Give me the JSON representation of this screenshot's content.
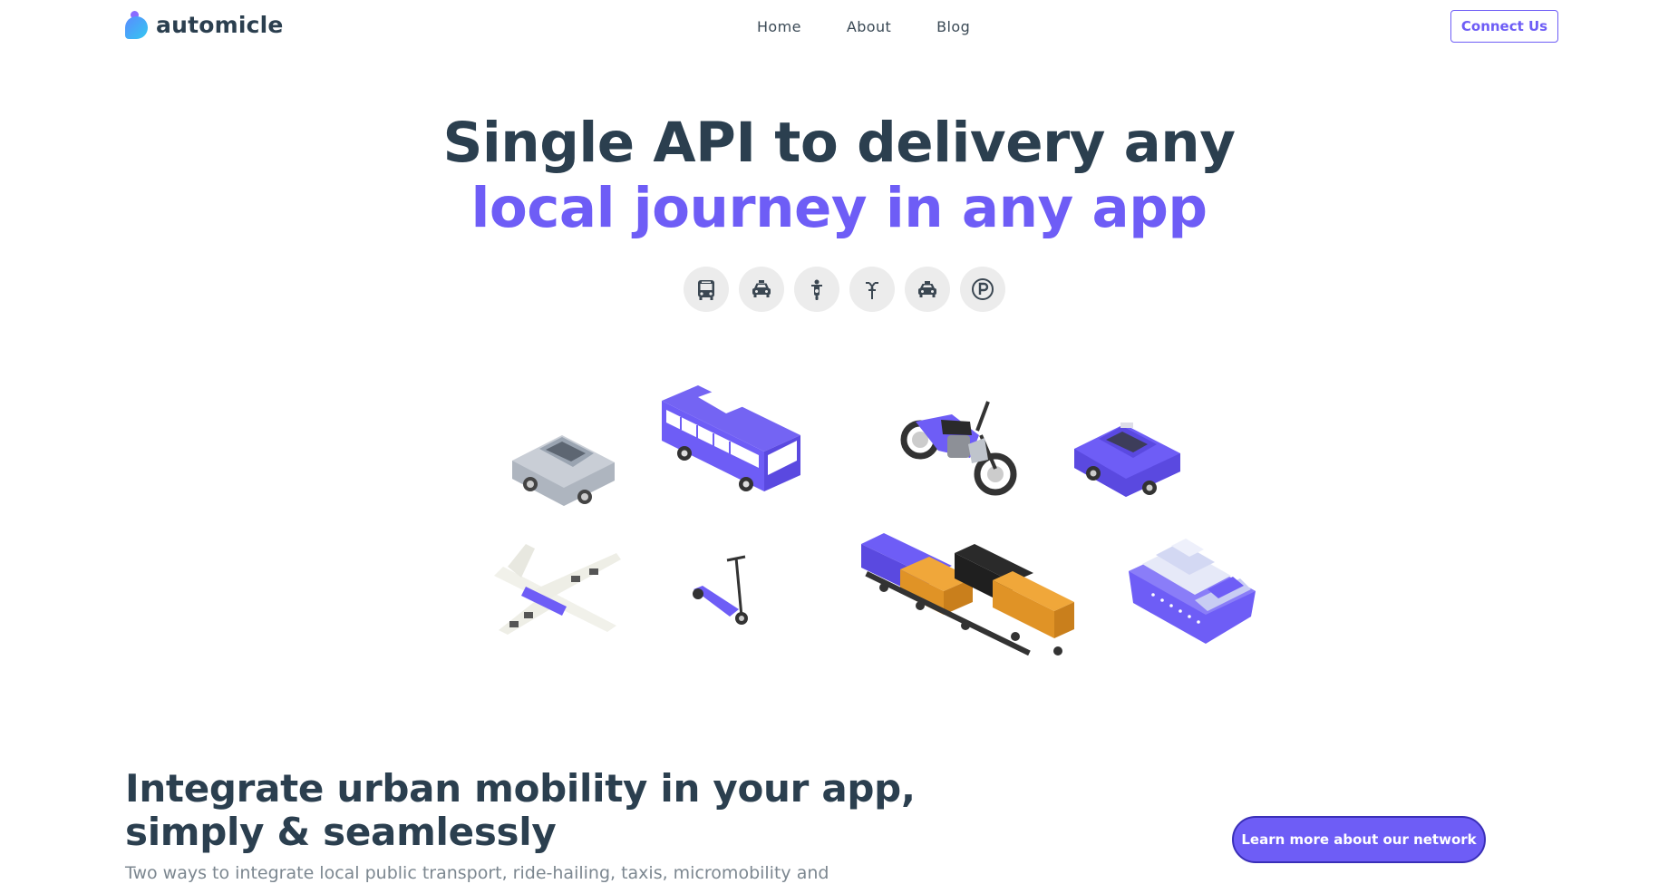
{
  "brand": {
    "name": "automicle"
  },
  "nav": {
    "items": [
      "Home",
      "About",
      "Blog"
    ],
    "cta": "Connect Us"
  },
  "hero": {
    "line1": "Single API to delivery any",
    "line2": "local journey in any app",
    "mode_icons": [
      "bus-icon",
      "taxi-icon",
      "scooter-icon",
      "bike-icon",
      "car-icon",
      "parking-icon"
    ]
  },
  "vehicles": [
    "car",
    "bus",
    "motorcycle",
    "taxi",
    "airplane",
    "kick-scooter",
    "train",
    "cruise-ship"
  ],
  "section": {
    "title_line1": "Integrate urban mobility in your app,",
    "title_line2": "simply & seamlessly",
    "subtitle": "Two ways to integrate local public transport, ride-hailing, taxis, micromobility and",
    "cta": "Learn more about our network"
  },
  "colors": {
    "accent": "#6e5df6",
    "heading": "#2b3f4f",
    "icon_bg": "#ececec"
  }
}
